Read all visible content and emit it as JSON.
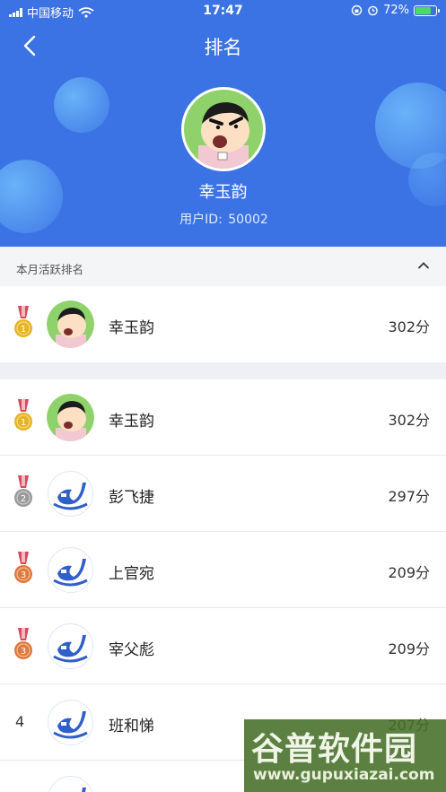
{
  "status_bar": {
    "carrier": "中国移动",
    "time": "17:47",
    "battery": "72%",
    "battery_level": 0.72
  },
  "header": {
    "title": "排名",
    "back_icon": "chevron-left-icon"
  },
  "profile": {
    "name": "幸玉韵",
    "id_label": "用户ID:",
    "id_value": "50002"
  },
  "section": {
    "label": "本月活跃排名",
    "toggle_icon": "chevron-up-icon"
  },
  "my_rank": {
    "rank": 1,
    "name": "幸玉韵",
    "score": "302分",
    "avatar": "cartoon-avatar"
  },
  "rankings": [
    {
      "rank": 1,
      "name": "幸玉韵",
      "score": "302分",
      "avatar": "cartoon-avatar"
    },
    {
      "rank": 2,
      "name": "彭飞捷",
      "score": "297分",
      "avatar": "logo-avatar"
    },
    {
      "rank": 3,
      "name": "上官宛",
      "score": "209分",
      "avatar": "logo-avatar"
    },
    {
      "rank": 3,
      "name": "宰父彪",
      "score": "209分",
      "avatar": "logo-avatar"
    },
    {
      "rank": 4,
      "rank_text": "4",
      "name": "班和悌",
      "score": "207分",
      "avatar": "logo-avatar"
    }
  ],
  "watermark": {
    "main": "谷普软件园",
    "url": "www.gupuxiazai.com"
  },
  "colors": {
    "header_bg": "#3b72e4",
    "gold": "#e6b422",
    "silver": "#9a9a9a",
    "bronze": "#e0793a",
    "ribbon": "#d94a5c"
  }
}
